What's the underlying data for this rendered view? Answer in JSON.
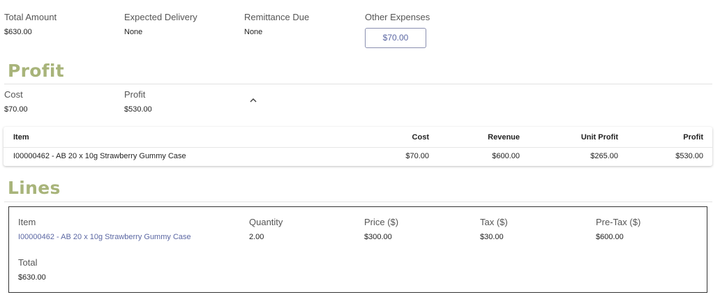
{
  "summary": {
    "total_amount": {
      "label": "Total Amount",
      "value": "$630.00"
    },
    "expected_delivery": {
      "label": "Expected Delivery",
      "value": "None"
    },
    "remittance_due": {
      "label": "Remittance Due",
      "value": "None"
    },
    "other_expenses": {
      "label": "Other Expenses",
      "value": "$70.00"
    }
  },
  "profit_section": {
    "title": "Profit",
    "cost": {
      "label": "Cost",
      "value": "$70.00"
    },
    "profit": {
      "label": "Profit",
      "value": "$530.00"
    },
    "table": {
      "headers": [
        "Item",
        "Cost",
        "Revenue",
        "Unit Profit",
        "Profit"
      ],
      "rows": [
        [
          "I00000462 - AB 20 x 10g Strawberry Gummy Case",
          "$70.00",
          "$600.00",
          "$265.00",
          "$530.00"
        ]
      ]
    }
  },
  "lines_section": {
    "title": "Lines",
    "line": {
      "item": {
        "label": "Item",
        "value": "I00000462 - AB 20 x 10g Strawberry Gummy Case"
      },
      "quantity": {
        "label": "Quantity",
        "value": "2.00"
      },
      "price": {
        "label": "Price ($)",
        "value": "$300.00"
      },
      "tax": {
        "label": "Tax ($)",
        "value": "$30.00"
      },
      "pretax": {
        "label": "Pre-Tax ($)",
        "value": "$600.00"
      },
      "total": {
        "label": "Total",
        "value": "$630.00"
      }
    }
  },
  "icons": {
    "collapse": "chevron-up-icon"
  },
  "colors": {
    "section_title": "#a8b47a",
    "link": "#5b67a3",
    "input_border": "#8a8fb0"
  }
}
